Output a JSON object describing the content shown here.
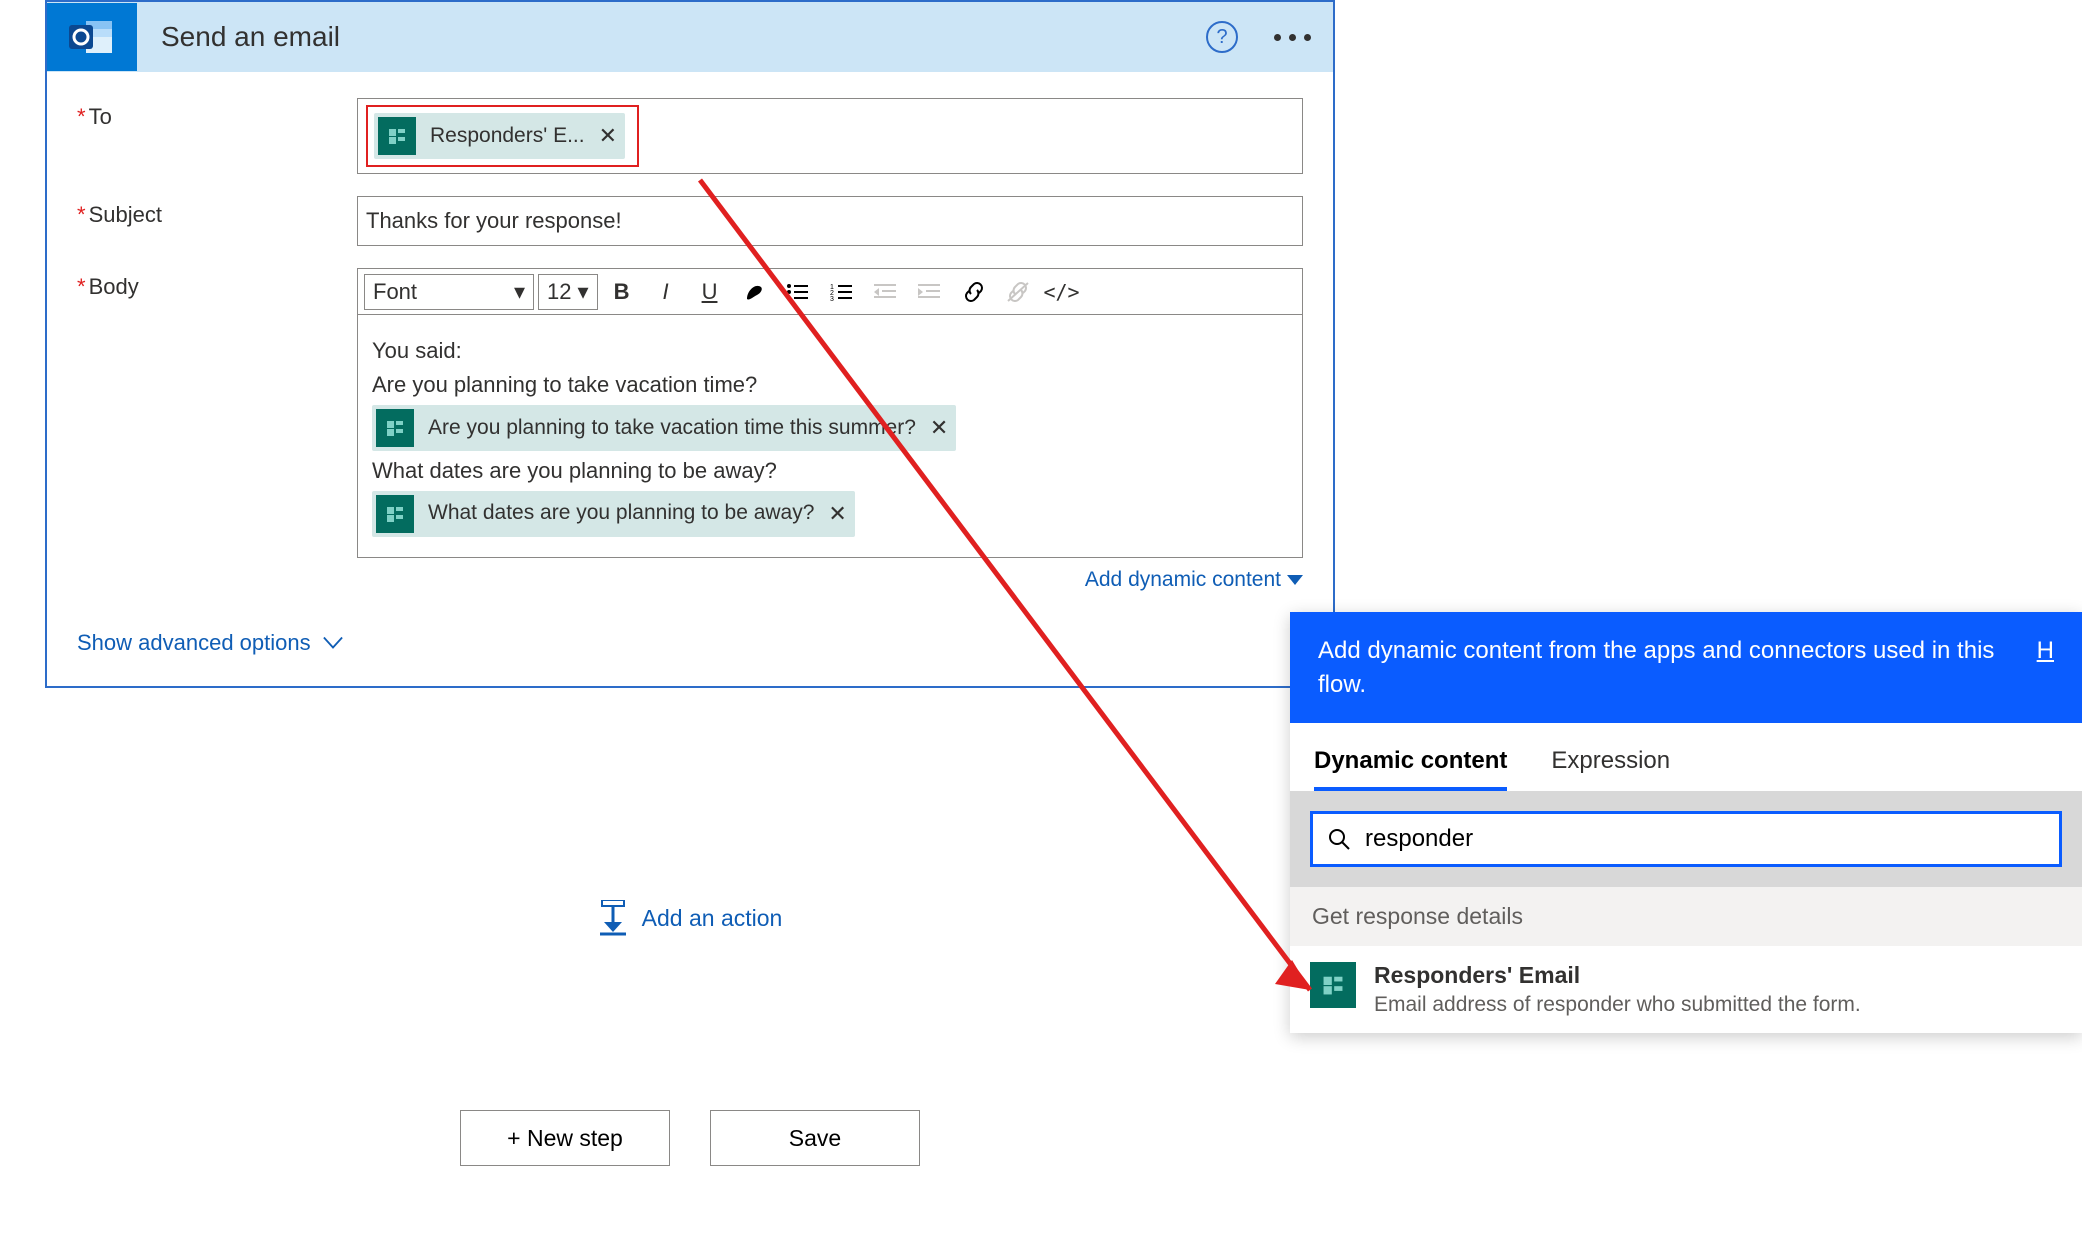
{
  "card": {
    "title": "Send an email",
    "fields": {
      "to_label": "To",
      "subject_label": "Subject",
      "body_label": "Body"
    },
    "to_token": "Responders' E...",
    "subject_value": "Thanks for your response!",
    "body": {
      "line1": "You said:",
      "line2": "Are you planning to take vacation time?",
      "token1": "Are you planning to take vacation time this summer?",
      "line3": "What dates are you planning to be away?",
      "token2": "What dates are you planning to be away?"
    },
    "rte": {
      "font_label": "Font",
      "size_label": "12"
    },
    "add_dynamic_label": "Add dynamic content",
    "advanced_label": "Show advanced options"
  },
  "add_action_label": "Add an action",
  "buttons": {
    "new_step": "+ New step",
    "save": "Save"
  },
  "dyn_panel": {
    "header": "Add dynamic content from the apps and connectors used in this flow.",
    "header_link": "H",
    "tab_dynamic": "Dynamic content",
    "tab_expression": "Expression",
    "search_value": "responder",
    "group_title": "Get response details",
    "item_title": "Responders' Email",
    "item_desc": "Email address of responder who submitted the form."
  }
}
